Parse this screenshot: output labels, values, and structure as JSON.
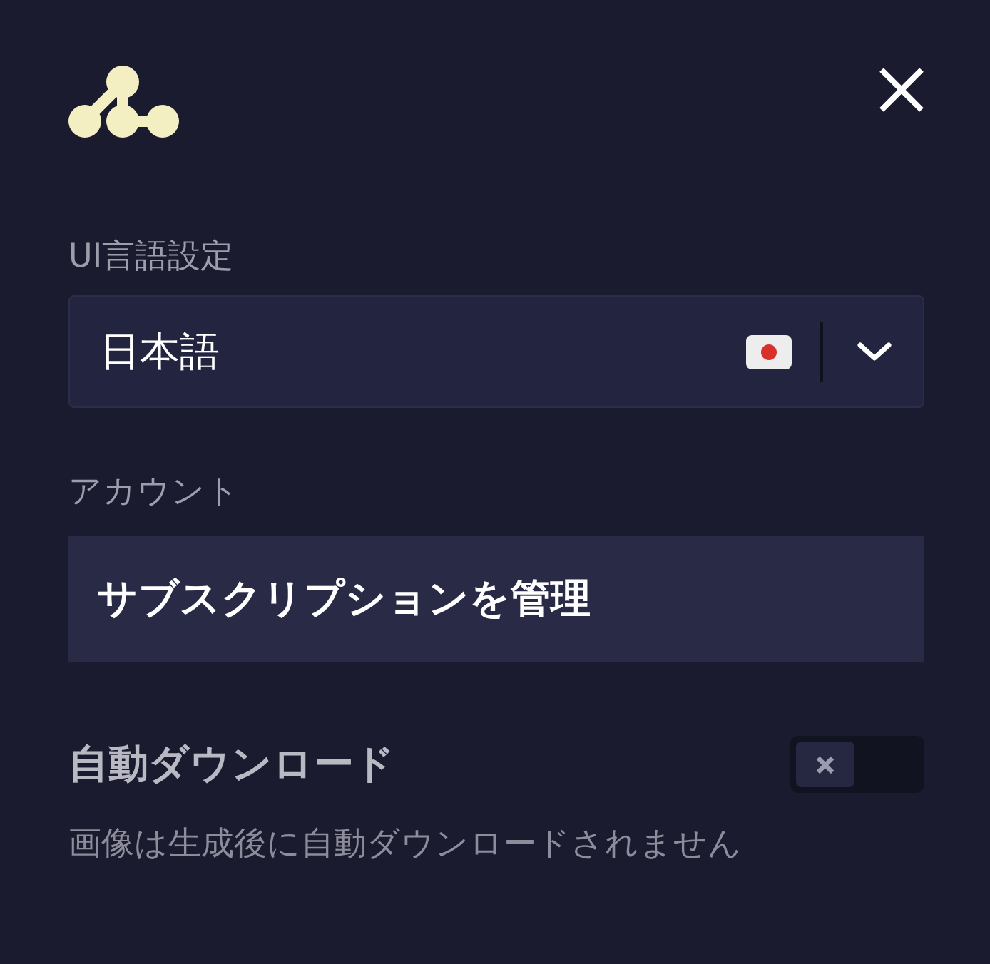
{
  "language": {
    "label": "UI言語設定",
    "value": "日本語"
  },
  "account": {
    "label": "アカウント",
    "button": "サブスクリプションを管理"
  },
  "auto_download": {
    "title": "自動ダウンロード",
    "on": false,
    "description": "画像は生成後に自動ダウンロードされません"
  }
}
